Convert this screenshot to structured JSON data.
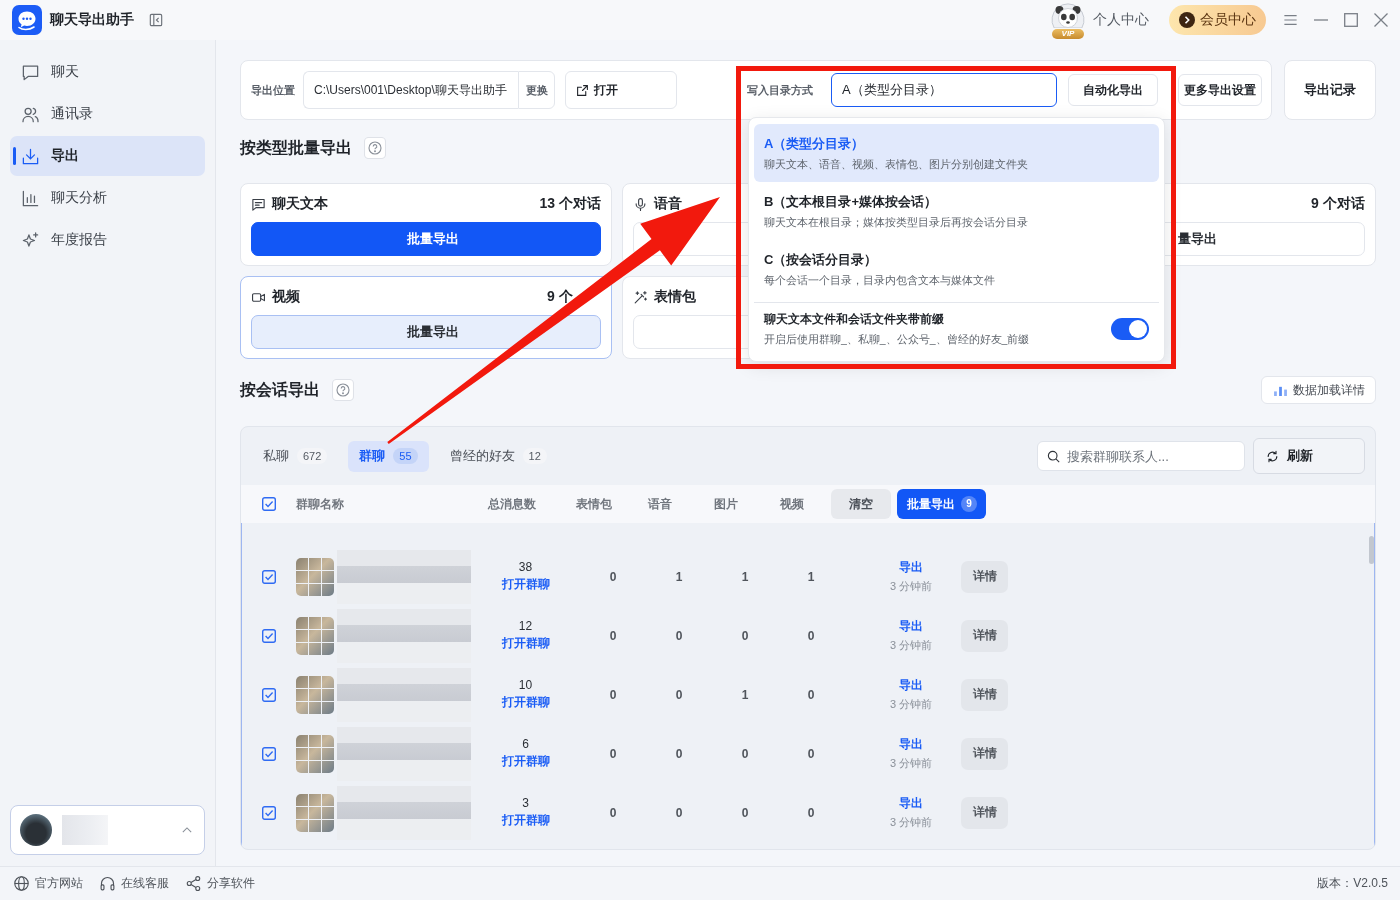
{
  "app": {
    "title": "聊天导出助手"
  },
  "titlebar": {
    "vip_badge": "VIP",
    "profile_label": "个人中心",
    "member_button": "会员中心"
  },
  "sidebar": {
    "items": [
      {
        "kind": "chat",
        "label": "聊天",
        "selected": false
      },
      {
        "kind": "contacts",
        "label": "通讯录",
        "selected": false
      },
      {
        "kind": "export",
        "label": "导出",
        "selected": true
      },
      {
        "kind": "analysis",
        "label": "聊天分析",
        "selected": false
      },
      {
        "kind": "report",
        "label": "年度报告",
        "selected": false
      }
    ]
  },
  "export_settings": {
    "location_label": "导出位置",
    "path": "C:\\Users\\001\\Desktop\\聊天导出助手",
    "change_button": "更换",
    "open_button": "打开",
    "dir_mode": {
      "label": "写入目录方式",
      "value": "A（类型分目录）",
      "expanded": true,
      "options": [
        {
          "label": "A（类型分目录）",
          "description": "聊天文本、语音、视频、表情包、图片分别创建文件夹",
          "selected": true
        },
        {
          "label": "B（文本根目录+媒体按会话）",
          "description": "聊天文本在根目录；媒体按类型目录后再按会话分目录",
          "selected": false
        },
        {
          "label": "C（按会话分目录）",
          "description": "每个会话一个目录，目录内包含文本与媒体文件",
          "selected": false
        }
      ],
      "prefix_toggle": {
        "label": "聊天文本文件和会话文件夹带前缀",
        "description": "开启后使用群聊_、私聊_、公众号_、曾经的好友_前缀",
        "on": true
      }
    },
    "auto_button": "自动化导出",
    "more_button": "更多导出设置"
  },
  "records_button": "导出记录",
  "type_export": {
    "title": "按类型批量导出",
    "cards": [
      {
        "kind": "text",
        "title": "聊天文本",
        "count": "13 个对话",
        "button": "批量导出",
        "active": true,
        "selected": false
      },
      {
        "kind": "voice",
        "title": "语音",
        "active": false,
        "selected": false
      },
      {
        "count": "9 个对话",
        "button": "量导出",
        "active": false,
        "selected": false
      },
      {
        "kind": "video",
        "title": "视频",
        "count": "9 个",
        "button": "批量导出",
        "active": false,
        "selected": true
      },
      {
        "kind": "emoji",
        "title": "表情包",
        "active": false,
        "selected": false
      }
    ]
  },
  "session_export": {
    "title": "按会话导出",
    "load_details_button": "数据加载详情",
    "tabs": [
      {
        "label": "私聊",
        "count": "672",
        "selected": false
      },
      {
        "label": "群聊",
        "count": "55",
        "selected": true
      },
      {
        "label": "曾经的好友",
        "count": "12",
        "selected": false
      }
    ],
    "search": {
      "placeholder": "搜索群聊联系人..."
    },
    "refresh_button": "刷新",
    "table": {
      "all_checked": true,
      "columns": [
        "群聊名称",
        "总消息数",
        "表情包",
        "语音",
        "图片",
        "视频"
      ],
      "clear_button": "清空",
      "batch_button": "批量导出",
      "batch_count": "9",
      "rows": [
        {
          "checked": true,
          "messages": "38",
          "open_link": "打开群聊",
          "emoji": "0",
          "voice": "1",
          "image": "1",
          "video": "1",
          "export_link": "导出",
          "export_time": "3 分钟前",
          "details_button": "详情"
        },
        {
          "checked": true,
          "messages": "12",
          "open_link": "打开群聊",
          "emoji": "0",
          "voice": "0",
          "image": "0",
          "video": "0",
          "export_link": "导出",
          "export_time": "3 分钟前",
          "details_button": "详情"
        },
        {
          "checked": true,
          "messages": "10",
          "open_link": "打开群聊",
          "emoji": "0",
          "voice": "0",
          "image": "1",
          "video": "0",
          "export_link": "导出",
          "export_time": "3 分钟前",
          "details_button": "详情"
        },
        {
          "checked": true,
          "messages": "6",
          "open_link": "打开群聊",
          "emoji": "0",
          "voice": "0",
          "image": "0",
          "video": "0",
          "export_link": "导出",
          "export_time": "3 分钟前",
          "details_button": "详情"
        },
        {
          "checked": true,
          "messages": "3",
          "open_link": "打开群聊",
          "emoji": "0",
          "voice": "0",
          "image": "0",
          "video": "0",
          "export_link": "导出",
          "export_time": "3 分钟前",
          "details_button": "详情"
        }
      ]
    }
  },
  "footer": {
    "links": [
      {
        "kind": "globe",
        "label": "官方网站"
      },
      {
        "kind": "headset",
        "label": "在线客服"
      },
      {
        "kind": "share",
        "label": "分享软件"
      }
    ],
    "version": "版本：V2.0.5"
  }
}
